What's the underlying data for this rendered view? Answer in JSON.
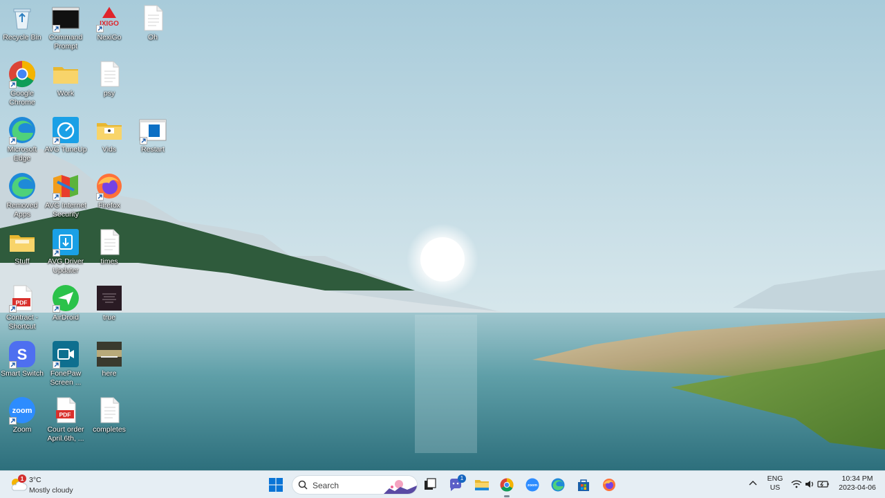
{
  "desktop": {
    "icons": [
      {
        "label": "Recycle Bin",
        "icon": "recycle-bin-icon"
      },
      {
        "label": "Command Prompt",
        "icon": "command-prompt-icon"
      },
      {
        "label": "NexiGo",
        "icon": "nexigo-icon",
        "brand_text": "IXIGO"
      },
      {
        "label": "Oh",
        "icon": "document-icon"
      },
      {
        "label": "Google Chrome",
        "icon": "chrome-icon"
      },
      {
        "label": "Work",
        "icon": "folder-icon"
      },
      {
        "label": "psy",
        "icon": "document-icon"
      },
      {
        "label": "Microsoft Edge",
        "icon": "edge-icon"
      },
      {
        "label": "AVG TuneUp",
        "icon": "avg-tuneup-icon"
      },
      {
        "label": "Vids",
        "icon": "folder-icon"
      },
      {
        "label": "Restart",
        "icon": "restart-icon"
      },
      {
        "label": "Removed Apps",
        "icon": "edge-icon"
      },
      {
        "label": "AVG Internet Security",
        "icon": "avg-internet-security-icon"
      },
      {
        "label": "Firefox",
        "icon": "firefox-icon"
      },
      {
        "label": "Stuff",
        "icon": "folder-icon"
      },
      {
        "label": "AVG Driver Updater",
        "icon": "avg-driver-updater-icon"
      },
      {
        "label": "times",
        "icon": "document-icon"
      },
      {
        "label": "Contract - Shortcut",
        "icon": "pdf-icon",
        "badge_text": "PDF"
      },
      {
        "label": "AirDroid",
        "icon": "airdroid-icon"
      },
      {
        "label": "true",
        "icon": "image-thumbnail-icon"
      },
      {
        "label": "Smart Switch",
        "icon": "smart-switch-icon"
      },
      {
        "label": "FonePaw Screen ...",
        "icon": "fonepaw-icon"
      },
      {
        "label": "here",
        "icon": "image-thumbnail-icon"
      },
      {
        "label": "Zoom",
        "icon": "zoom-icon",
        "brand_text": "zoom"
      },
      {
        "label": "Court order April.6th, ...",
        "icon": "pdf-icon",
        "badge_text": "PDF"
      },
      {
        "label": "completes",
        "icon": "document-icon"
      }
    ]
  },
  "taskbar": {
    "weather": {
      "temp": "3°C",
      "condition": "Mostly cloudy",
      "badge": "1"
    },
    "search": {
      "label": "Search"
    },
    "chat_badge": "1",
    "zoom_text": "zoom",
    "tray": {
      "lang_top": "ENG",
      "lang_bottom": "US"
    },
    "clock": {
      "time": "10:34 PM",
      "date": "2023-04-06"
    }
  },
  "colors": {
    "taskbar_bg": "#e6eef4",
    "accent": "#0078d4"
  }
}
